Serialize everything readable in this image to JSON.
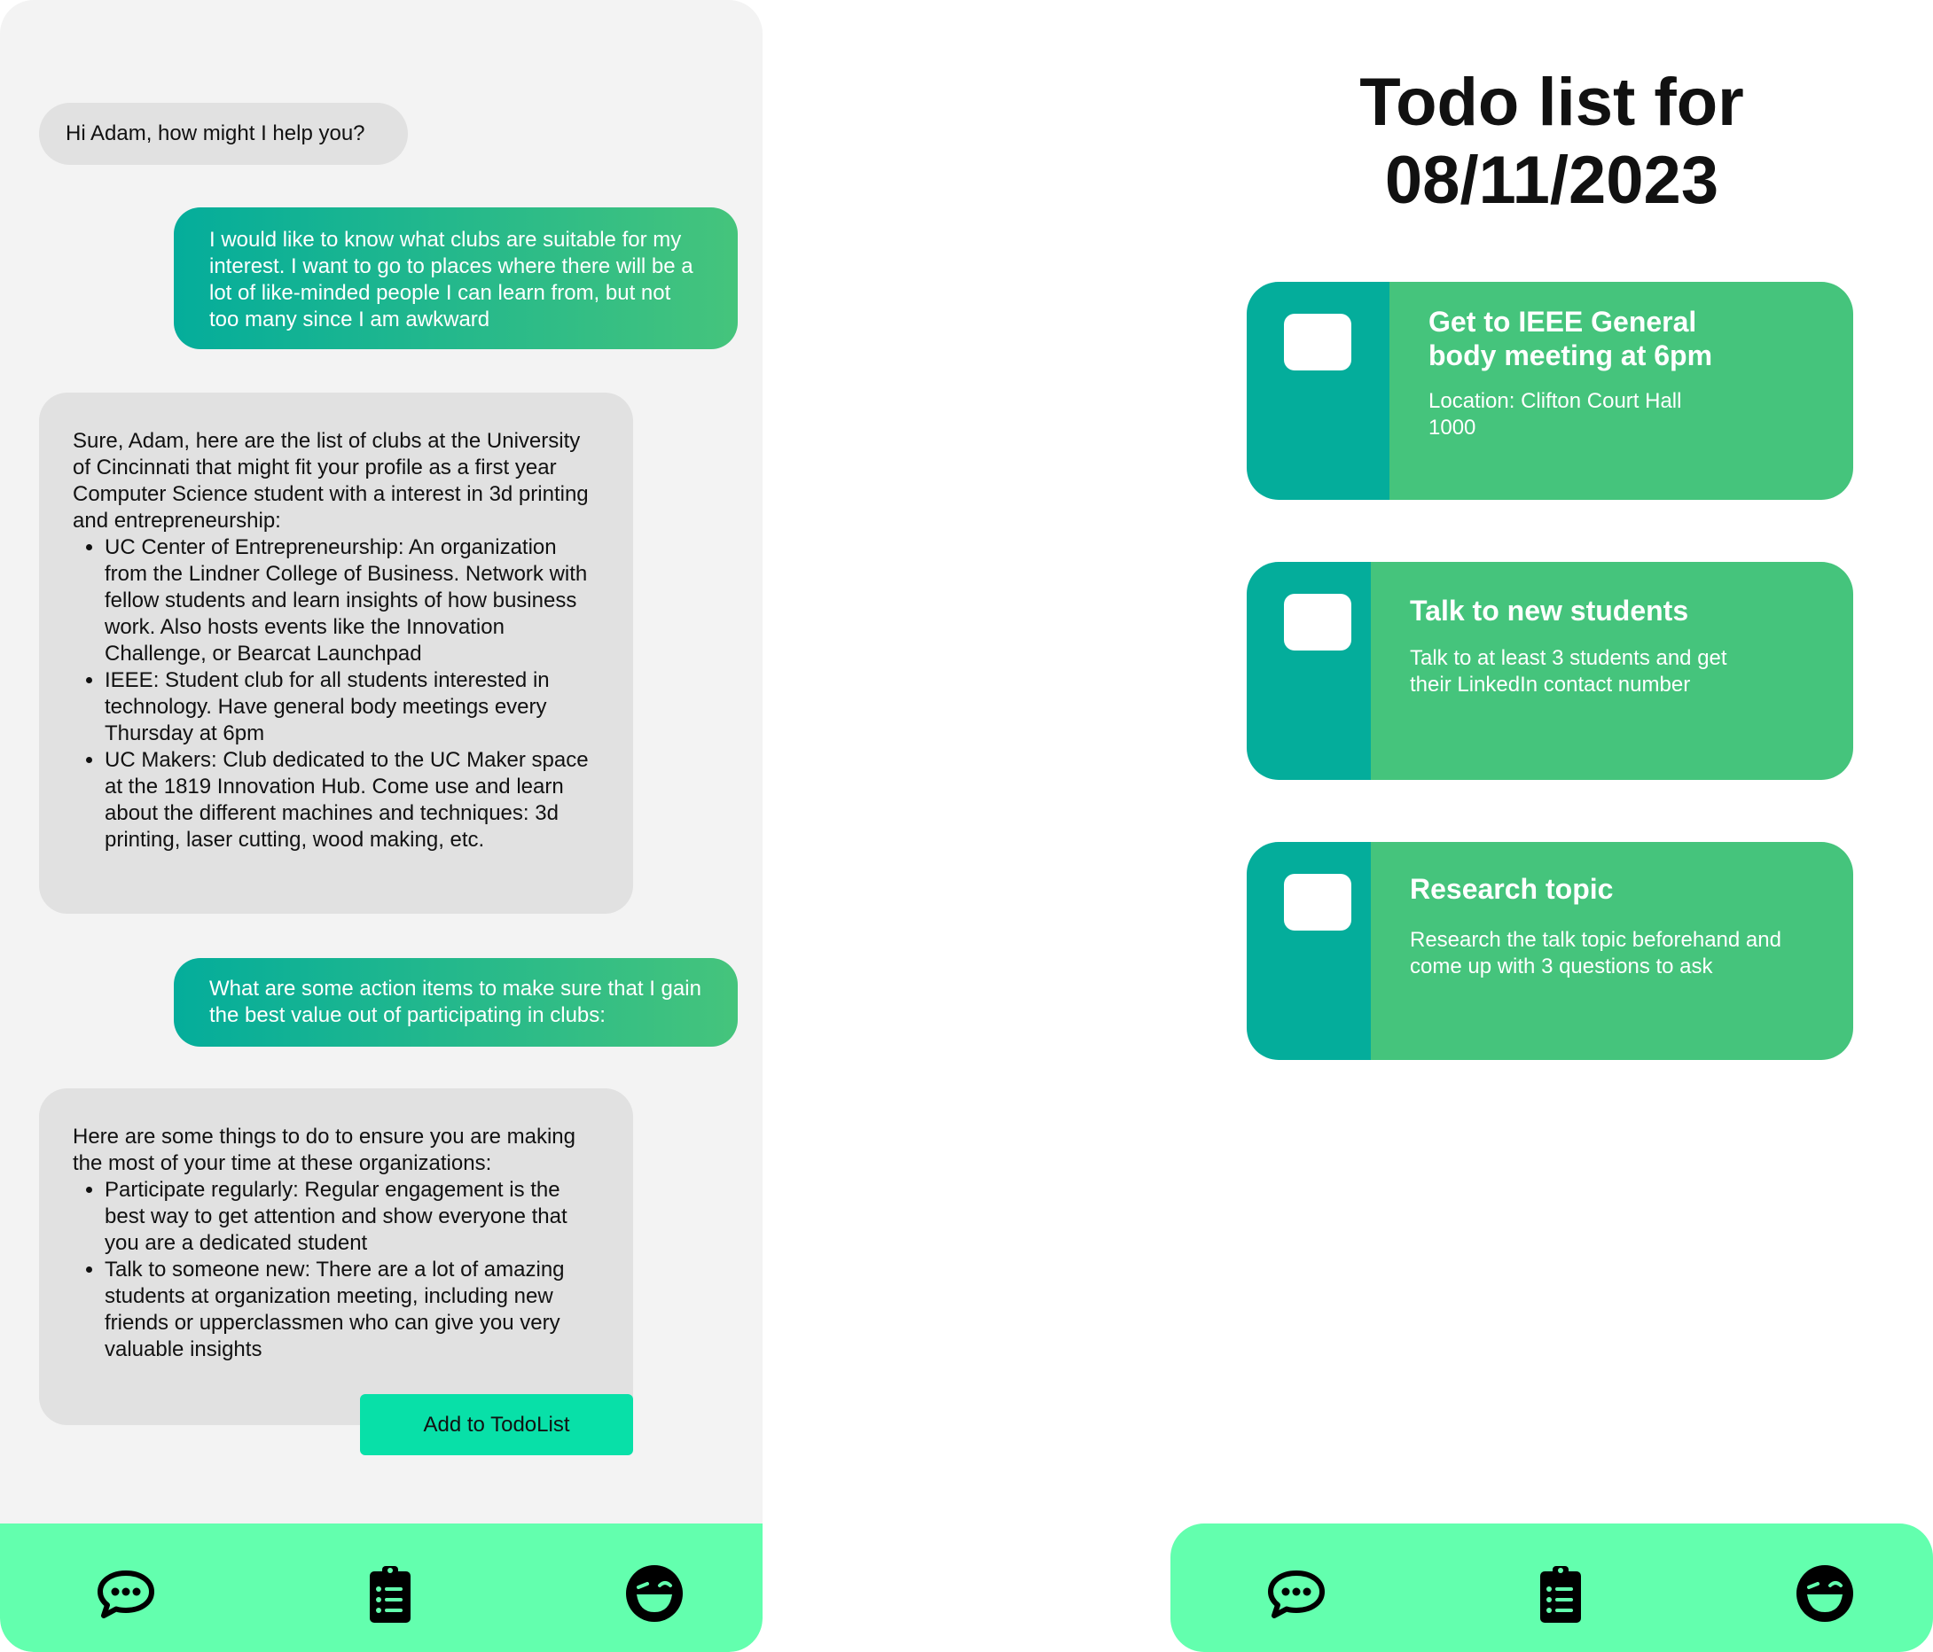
{
  "chat": {
    "messages": [
      {
        "role": "bot",
        "text": "Hi Adam, how might I help you?"
      },
      {
        "role": "user",
        "text": "I would like to know what clubs are suitable for my interest. I want to go to places where there will be a lot of like-minded people I can learn from, but not too many since I am awkward"
      },
      {
        "role": "bot",
        "intro": "Sure, Adam, here are the list of clubs at the University of Cincinnati that might fit your profile as a first year Computer Science student with a interest in 3d printing and entrepreneurship:",
        "items": [
          "UC Center of Entrepreneurship: An organization from the Lindner College of Business. Network with fellow students and learn insights of how business work. Also hosts events like the Innovation Challenge, or Bearcat Launchpad",
          "IEEE: Student club for all students interested in technology. Have general body meetings every Thursday at 6pm",
          "UC Makers: Club dedicated to the UC Maker space at the 1819 Innovation Hub. Come use and learn about the different machines and techniques: 3d printing, laser cutting, wood making, etc."
        ]
      },
      {
        "role": "user",
        "text": "What are some action items to make sure that I gain the best value out of participating in clubs:"
      },
      {
        "role": "bot",
        "intro": "Here are some things to do to ensure you are making the most of your time at these organizations:",
        "items": [
          "Participate regularly: Regular engagement is the best way to get attention and show everyone that you are a dedicated student",
          "Talk to someone new: There are a lot of amazing students at organization meeting, including new friends or upperclassmen who can give you very valuable insights"
        ]
      }
    ],
    "add_button_label": "Add to TodoList"
  },
  "todo": {
    "title_line1": "Todo list for",
    "title_line2": "08/11/2023",
    "items": [
      {
        "title": "Get to IEEE General body meeting at 6pm",
        "description": "Location: Clifton Court Hall 1000",
        "checked": false
      },
      {
        "title": "Talk to new students",
        "description": "Talk to at least 3 students and get their LinkedIn contact number",
        "checked": false
      },
      {
        "title": "Research topic",
        "description": "Research the talk topic beforehand and come up with 3 questions to ask",
        "checked": false
      }
    ]
  },
  "nav": {
    "icons": [
      "chat-bubble-icon",
      "clipboard-list-icon",
      "winking-face-icon"
    ]
  },
  "colors": {
    "chat_bg": "#f3f3f3",
    "bot_bubble": "#e1e1e1",
    "user_gradient_start": "#04ad9b",
    "user_gradient_end": "#45c47c",
    "add_button": "#08e0a8",
    "nav_bg": "#63ffae",
    "card_check_col": "#04ad9b",
    "card_body": "#45c47c"
  }
}
